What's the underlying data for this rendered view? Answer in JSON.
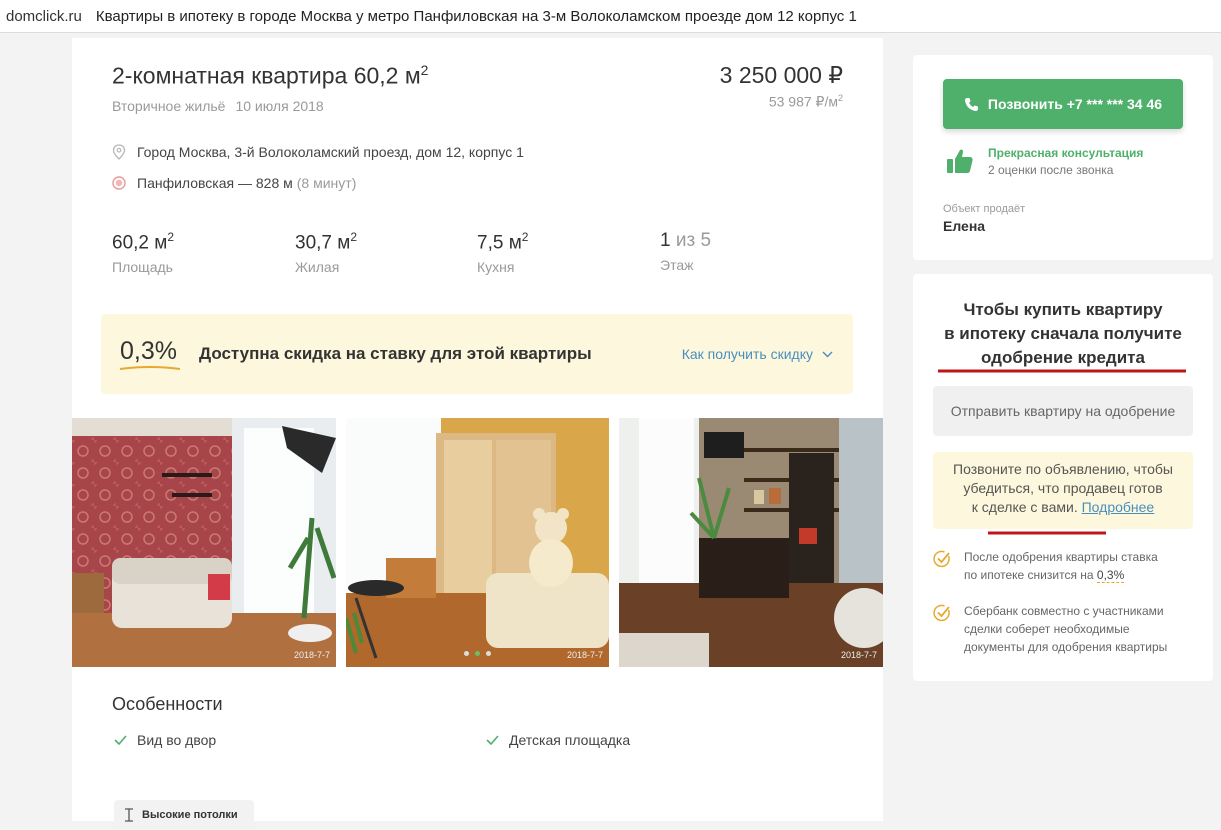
{
  "browser": {
    "site": "domclick.ru",
    "tab_title": "Квартиры в ипотеку в городе Москва у метро Панфиловская на 3-м Волоколамском проезде дом 12 корпус 1"
  },
  "listing": {
    "title": "2-комнатная квартира 60,2 м",
    "title_sup": "2",
    "type": "Вторичное жильё",
    "date": "10 июля 2018",
    "price": "3 250 000 ₽",
    "price_per_m": "53 987 ₽/м",
    "price_per_m_sup": "2",
    "address": "Город Москва, 3-й Волоколамский проезд, дом 12, корпус 1",
    "metro_name": "Панфиловская — 828 м",
    "metro_time": "(8 минут)"
  },
  "stats": [
    {
      "value": "60,2 м",
      "sup": "2",
      "label": "Площадь"
    },
    {
      "value": "30,7 м",
      "sup": "2",
      "label": "Жилая"
    },
    {
      "value": "7,5 м",
      "sup": "2",
      "label": "Кухня"
    },
    {
      "value": "1",
      "extra": "из 5",
      "label": "Этаж"
    }
  ],
  "discount": {
    "percent": "0,3%",
    "text": "Доступна скидка на ставку для этой квартиры",
    "link": "Как получить скидку",
    "underline_color": "#e7a92d"
  },
  "photos": [
    {
      "date": "2018-7-7"
    },
    {
      "date": "2018-7-7"
    },
    {
      "date": "2018-7-7"
    }
  ],
  "features": {
    "heading": "Особенности",
    "items": [
      "Вид  во двор",
      "Детская площадка"
    ],
    "chip": "Высокие потолки"
  },
  "contact": {
    "call_label": "Позвонить +7 *** *** 34 46",
    "rating_title": "Прекрасная консультация",
    "rating_sub": "2 оценки после звонка",
    "seller_label": "Объект продаёт",
    "seller_name": "Елена",
    "accent": "#4fb06c"
  },
  "approval": {
    "heading_line1": "Чтобы купить квартиру",
    "heading_line2": "в ипотеку сначала получите",
    "heading_line3": "одобрение кредита",
    "send_button": "Отправить квартиру на одобрение",
    "notice_line1": "Позвоните по объявлению, чтобы",
    "notice_line2": "убедиться, что продавец готов",
    "notice_line3": "к сделке с вами.",
    "notice_more": "Подробнее",
    "bullet1_a": "После одобрения квартиры ставка",
    "bullet1_b": "по ипотеке снизится на",
    "bullet1_pct": "0,3%",
    "bullet2_a": "Сбербанк совместно с участниками",
    "bullet2_b": "сделки соберет необходимые",
    "bullet2_c": "документы для одобрения квартиры",
    "annotation_color": "#c0141b"
  }
}
